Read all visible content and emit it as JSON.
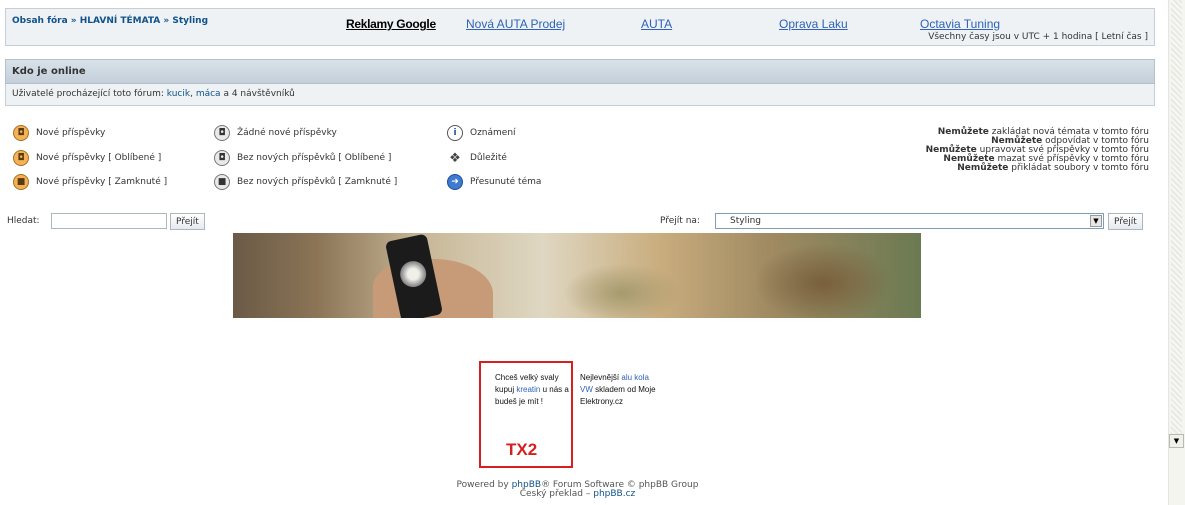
{
  "topbar": {
    "breadcrumb": "Obsah fóra » HLAVNÍ TÉMATA » Styling",
    "ads": {
      "title": "Reklamy Google",
      "links": [
        "Nová AUTA Prodej",
        "AUTA",
        "Oprava Laku",
        "Octavia Tuning"
      ]
    },
    "timezone": "Všechny časy jsou v UTC + 1 hodina [ Letní čas ]"
  },
  "online": {
    "title": "Kdo je online",
    "prefix": "Uživatelé procházející toto fórum:",
    "user1": "kucik",
    "sep": ",",
    "user2": "máca",
    "suffix": "a 4 návštěvníků"
  },
  "legend": {
    "new_posts": "Nové příspěvky",
    "new_posts_hot": "Nové příspěvky [ Oblíbené ]",
    "new_posts_locked": "Nové příspěvky [ Zamknuté ]",
    "no_new": "Žádné nové příspěvky",
    "no_new_hot": "Bez nových příspěvků [ Oblíbené ]",
    "no_new_locked": "Bez nových příspěvků [ Zamknuté ]",
    "announce": "Oznámení",
    "sticky": "Důležité",
    "moved": "Přesunuté téma"
  },
  "permissions": {
    "word": "Nemůžete",
    "lines": [
      "zakládat nová témata v tomto fóru",
      "odpovídat v tomto fóru",
      "upravovat své příspěvky v tomto fóru",
      "mazat své příspěvky v tomto fóru",
      "přikládat soubory v tomto fóru"
    ]
  },
  "search": {
    "label": "Hledat:",
    "value": "",
    "button": "Přejít"
  },
  "jump": {
    "label": "Přejít na:",
    "selected": "Styling",
    "button": "Přejít"
  },
  "ads_box": {
    "ad1_a": "Chceš velký svaly kupuj",
    "ad1_link": "kreatin",
    "ad1_b": "u nás a budeš je mít !",
    "tx2": "TX2",
    "ad2_a": "Nejlevnější",
    "ad2_link": "alu kola VW",
    "ad2_b": "skladem od Moje Elektrony.cz"
  },
  "footer": {
    "powered_pre": "Powered by",
    "phpbb": "phpBB",
    "powered_post": "® Forum Software © phpBB Group",
    "czech_pre": "Český překlad –",
    "phpbb_cz": "phpBB.cz"
  },
  "colors": {
    "link": "#105289",
    "ad_red": "#d42020",
    "ad_link": "#2f62b8"
  },
  "icons": [
    "folder-new-icon",
    "folder-icon",
    "announce-icon",
    "sticky-icon",
    "moved-icon",
    "lock-icon",
    "dropdown-arrow-icon",
    "scroll-down-icon"
  ]
}
